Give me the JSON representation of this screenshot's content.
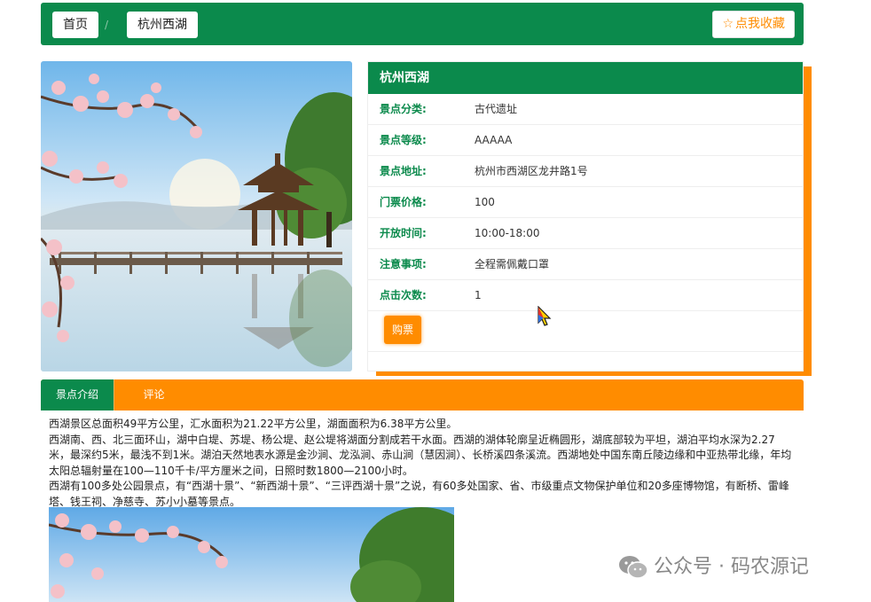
{
  "breadcrumb": {
    "home": "首页",
    "separator": "/",
    "current": "杭州西湖"
  },
  "favorite": {
    "icon": "star-outline-icon",
    "label": "点我收藏"
  },
  "card": {
    "title": "杭州西湖",
    "rows": [
      {
        "key": "景点分类:",
        "value": "古代遗址"
      },
      {
        "key": "景点等级:",
        "value": "AAAAA"
      },
      {
        "key": "景点地址:",
        "value": "杭州市西湖区龙井路1号"
      },
      {
        "key": "门票价格:",
        "value": "100"
      },
      {
        "key": "开放时间:",
        "value": "10:00-18:00"
      },
      {
        "key": "注意事项:",
        "value": "全程需佩戴口罩"
      },
      {
        "key": "点击次数:",
        "value": "1"
      }
    ],
    "buy_label": "购票"
  },
  "tabs": [
    {
      "label": "景点介绍",
      "active": true
    },
    {
      "label": "评论",
      "active": false
    }
  ],
  "description": [
    "西湖景区总面积49平方公里，汇水面积为21.22平方公里，湖面面积为6.38平方公里。",
    "西湖南、西、北三面环山，湖中白堤、苏堤、杨公堤、赵公堤将湖面分割成若干水面。西湖的湖体轮廓呈近椭圆形，湖底部较为平坦，湖泊平均水深为2.27米，最深约5米，最浅不到1米。湖泊天然地表水源是金沙涧、龙泓涧、赤山涧（慧因涧）、长桥溪四条溪流。西湖地处中国东南丘陵边缘和中亚热带北缘，年均太阳总辐射量在100—110千卡/平方厘米之间，日照时数1800—2100小时。",
    "西湖有100多处公园景点，有“西湖十景”、“新西湖十景”、“三评西湖十景”之说，有60多处国家、省、市级重点文物保护单位和20多座博物馆，有断桥、雷峰塔、钱王祠、净慈寺、苏小小墓等景点。"
  ],
  "watermark": {
    "icon": "wechat-icon",
    "text": "公众号 · 码农源记"
  },
  "colors": {
    "green": "#0b8a4c",
    "orange": "#ff8c00"
  }
}
